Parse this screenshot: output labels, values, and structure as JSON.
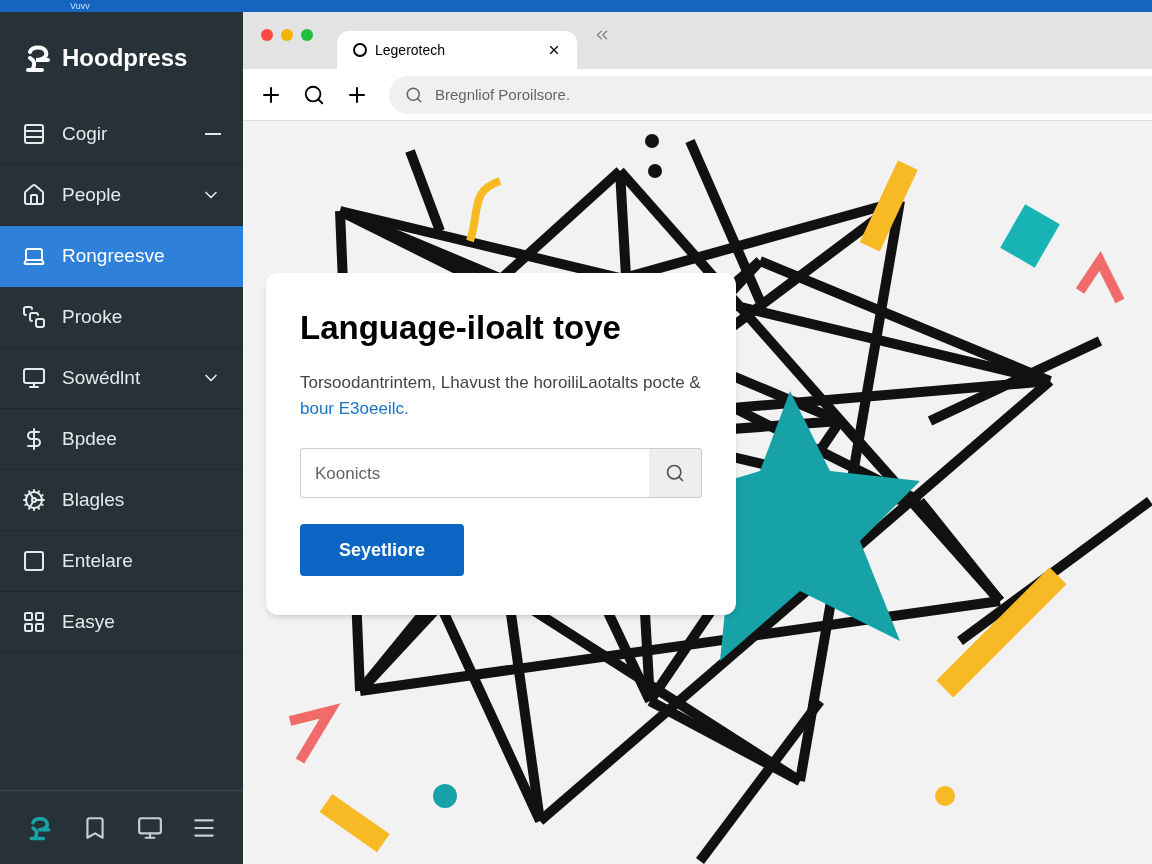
{
  "top_bar": {
    "text": "Vuvv"
  },
  "sidebar": {
    "brand": "Hoodpress",
    "items": [
      {
        "label": "Cogir",
        "selected": false
      },
      {
        "label": "People",
        "selected": false
      },
      {
        "label": "Rongreesve",
        "selected": true
      },
      {
        "label": "Prooke",
        "selected": false
      },
      {
        "label": "Sowédlnt",
        "selected": false
      },
      {
        "label": "Bpdee",
        "selected": false
      },
      {
        "label": "Blagles",
        "selected": false
      },
      {
        "label": "Entelare",
        "selected": false
      },
      {
        "label": "Easye",
        "selected": false
      }
    ]
  },
  "browser": {
    "tab": {
      "title": "Legerotech"
    },
    "address": {
      "placeholder": "Bregnliof Poroilsore."
    }
  },
  "card": {
    "title": "Language-iloalt toye",
    "description": "Torsoodantrintem, Lhavust the horoiliLaotalts pocte &",
    "link": "bour E3oeeilc.",
    "search": {
      "value": "Koonicts"
    },
    "button": "Seyetliore"
  }
}
